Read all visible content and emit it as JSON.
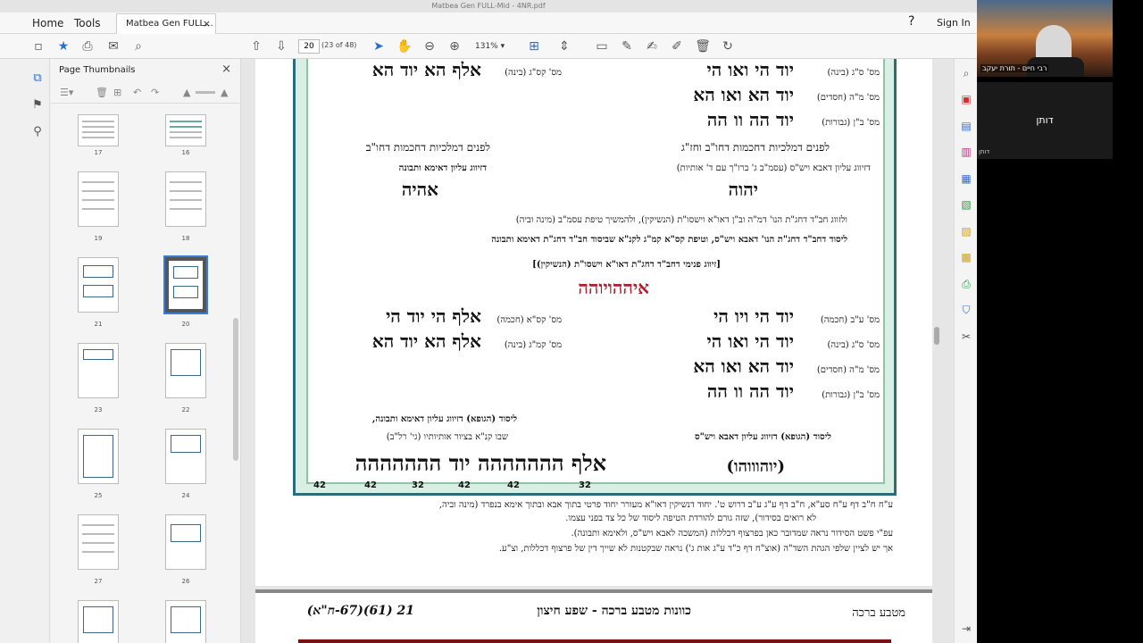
{
  "window": {
    "title": "Matbea Gen FULL-Mid - 4NR.pdf"
  },
  "menu": {
    "home": "Home",
    "tools": "Tools",
    "tab_label": "Matbea Gen FULL...",
    "tab_close": "×",
    "help": "?",
    "sign_in": "Sign In"
  },
  "toolbar": {
    "page_value": "20",
    "page_count": "(23 of 48)",
    "zoom": "131%"
  },
  "thumbnails": {
    "title": "Page Thumbnails",
    "close": "×",
    "pages": [
      "17",
      "16",
      "19",
      "18",
      "21",
      "20",
      "23",
      "22",
      "25",
      "24",
      "27",
      "26"
    ]
  },
  "doc": {
    "r1_right_label": "מס' ס\"ג (בינה)",
    "r1_right_text": "יוד הי ואו הי",
    "r1_left_label": "מס' קס\"ג (בינה)",
    "r1_left_text": "אלף הא יוד הא",
    "r2_right_label": "מס' מ\"ה (חסדים)",
    "r2_right_text": "יוד הא ואו הא",
    "r3_right_label": "מס' ב\"ן (גבורות)",
    "r3_right_text": "יוד הה וו הה",
    "m1_right": "לפנים דמלכיות דחכמות דחו\"ב וחז\"ג",
    "m1_left": "לפנים דמלכיות דחכמות דחו\"ב",
    "m2_right": "דזיווג עליון דאבא ויש\"ס (עסמ\"ב ג' ברו\"ך עם ד' אותיות)",
    "m2_left": "דזיווג עליון דאימא ותבונה",
    "name_right": "יהוה",
    "name_left": "אהיה",
    "p1": "ולזווג חב\"ד דחג\"ת הנו' דמ\"ה וב\"ן דאו\"א וישסו\"ת (הנשיקין), ולהמשיך טיפת עסמ\"ב (מינה וביה)",
    "p2": "ליסוד דחב\"ד דחג\"ת הנו' דאבא ויש\"ס, וטיפת קס\"א קמ\"ג לקנ\"א שביסוד חב\"ד דחג\"ת דאימא ותבונה",
    "bracket": "[זיווג פנימי דחב\"ד דחג\"ת דאו\"א וישסו\"ת (הנשיקין)]",
    "combined_name": "איההויוהה",
    "b1_right_label": "מס' ע\"ב (חכמה)",
    "b1_right_text": "יוד הי ויו הי",
    "b1_left_label": "מס' קס\"א (חכמה)",
    "b1_left_text": "אלף הי יוד הי",
    "b2_right_label": "מס' ס\"ג (בינה)",
    "b2_right_text": "יוד הי ואו הי",
    "b2_left_label": "מס' קמ\"ג (בינה)",
    "b2_left_text": "אלף הא יוד הא",
    "b3_right_label": "מס' מ\"ה (חסדים)",
    "b3_right_text": "יוד הא ואו הא",
    "b4_right_label": "מס' ב\"ן (גבורות)",
    "b4_right_text": "יוד הה וו הה",
    "y_left1": "ליסוד (הגופא) דזיווג עליון דאימא ותבונה,",
    "y_left2": "שבו קנ\"א בציור אותיותיו (גי' רל\"ב)",
    "y_right": "ליסוד (הגופא) דזיווג עליון דאבא ויש\"ס",
    "final_right": "(יוהוווהו)",
    "final_left": "אלף ההההההה יוד ההההההה",
    "nums": [
      "42",
      "42",
      "32",
      "42",
      "42",
      "32"
    ],
    "fn1": "ע\"ח ח\"ב דף ע\"ח סע\"א, ח\"ב דף ע\"ג ע\"ב דרוש ט'. יחוד דנשיקין דאו\"א מעורר יחוד פרטי בתוך אבא ובתוך אימא בנפרד (מינה וביה,",
    "fn2": "לא רואים בסידור), שזה גורם להורדת הטיפה ליסוד של כל צד בפני עצמו.",
    "fn3": "עפ\"י פשט הסידור נראה שמדובר כאן בפרצוף דכללות (המשכה לאבא ויש\"ס, ולאימא ותבונה).",
    "fn4": "אך יש לציין שלפי הגהת השד\"ה (אוצ\"ח דף כ\"ד ע\"ג אות ג') נראה שבקטנות לא שייך דין של פרצוף דכללות, וצ\"ע.",
    "p2_num": "21  (61)(67-ח\"א)",
    "p2_title": "כוונות מטבע ברכה - שפע חיצון",
    "p2_right": "מטבע ברכה"
  },
  "video": {
    "cam1_label": "רבי חיים - תורת יעקב",
    "cam2_name": "דותן",
    "cam2_label": "דותן"
  }
}
